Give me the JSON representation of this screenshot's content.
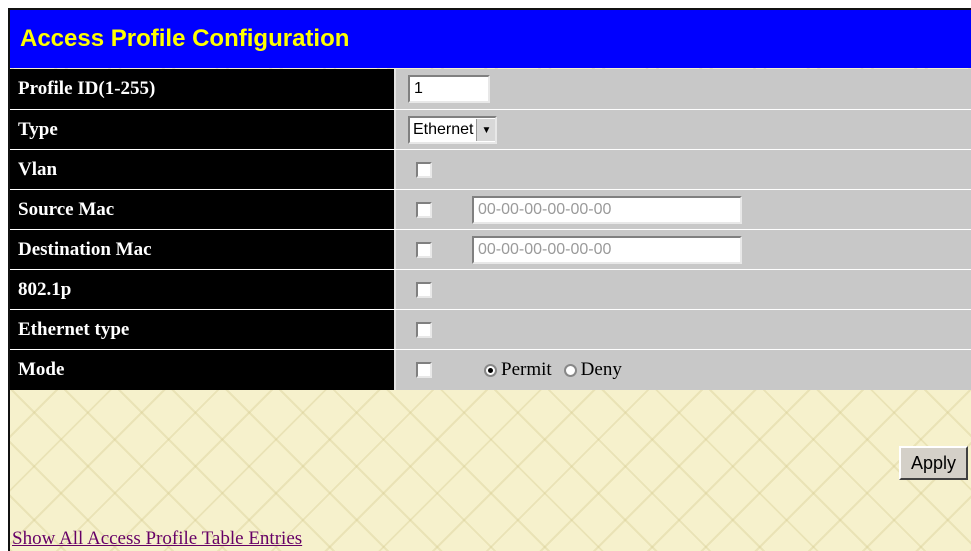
{
  "page": {
    "title": "Access Profile Configuration",
    "link_text": "Show All Access Profile Table Entries",
    "apply_label": "Apply"
  },
  "fields": {
    "profile_id": {
      "label": "Profile ID(1-255)",
      "value": "1"
    },
    "type": {
      "label": "Type",
      "selected": "Ethernet"
    },
    "vlan": {
      "label": "Vlan",
      "checked": false
    },
    "source_mac": {
      "label": "Source Mac",
      "checked": false,
      "value": "00-00-00-00-00-00"
    },
    "destination_mac": {
      "label": "Destination Mac",
      "checked": false,
      "value": "00-00-00-00-00-00"
    },
    "p8021": {
      "label": "802.1p",
      "checked": false
    },
    "ethernet_type": {
      "label": "Ethernet type",
      "checked": false
    },
    "mode": {
      "label": "Mode",
      "checked": false,
      "options": [
        "Permit",
        "Deny"
      ],
      "selected": "Permit"
    }
  },
  "colors": {
    "title_bg": "#0000ff",
    "title_text": "#ffff00",
    "label_bg": "#000000",
    "value_bg": "#c8c8c8",
    "page_bg": "#f6f1cc",
    "link": "#660066"
  }
}
